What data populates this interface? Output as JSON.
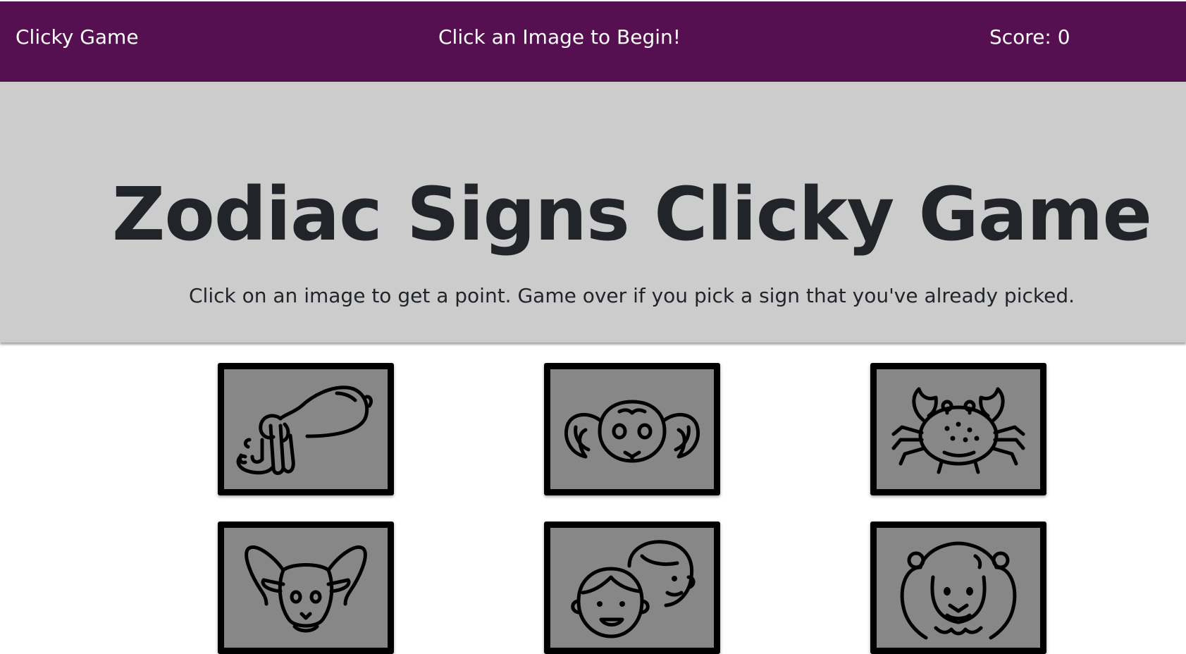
{
  "navbar": {
    "brand": "Clicky Game",
    "message": "Click an Image to Begin!",
    "score_label": "Score: 0",
    "background": "#561052"
  },
  "jumbotron": {
    "title": "Zodiac Signs Clicky Game",
    "lead": "Click on an image to get a point. Game over if you pick a sign that you've already picked.",
    "background": "#cccccc"
  },
  "cards": [
    {
      "icon": "aquarius-water-jug-icon"
    },
    {
      "icon": "aries-ram-face-icon"
    },
    {
      "icon": "cancer-crab-icon"
    },
    {
      "icon": "capricorn-goat-icon"
    },
    {
      "icon": "gemini-twins-icon"
    },
    {
      "icon": "leo-lion-icon"
    }
  ],
  "colors": {
    "card_border": "#000000",
    "card_fill": "#878787"
  }
}
